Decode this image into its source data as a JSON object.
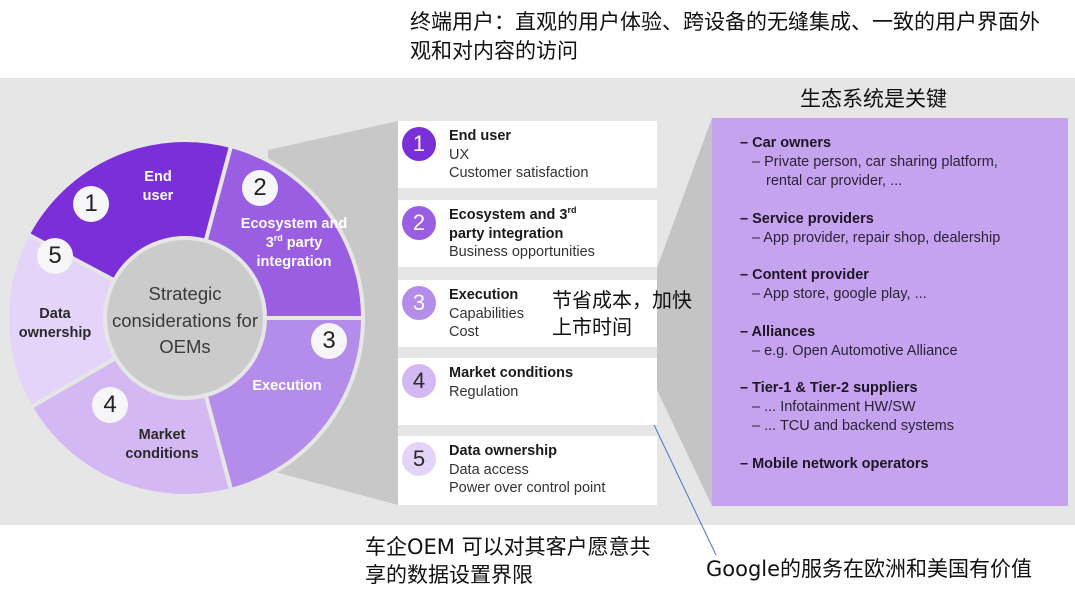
{
  "annotations": {
    "end_user_note": "终端用户：直观的用户体验、跨设备的无缝集成、一致的用户界面外观和对内容的访问",
    "ecosystem_note": "生态系统是关键",
    "execution_note": "节省成本，加快 上市时间",
    "data_ownership_note": "车企OEM 可以对其客户愿意共享的数据设置界限",
    "google_note": "Google的服务在欧洲和美国有价值"
  },
  "wheel": {
    "center_label": "Strategic considerations for OEMs",
    "segments": [
      {
        "number": "1",
        "label": "End user",
        "color": "#7b2fd8"
      },
      {
        "number": "2",
        "label_main": "Ecosystem and 3",
        "label_sup": "rd",
        "label_tail": " party integration",
        "color": "#9a5ee3"
      },
      {
        "number": "3",
        "label": "Execution",
        "color": "#b48ce9"
      },
      {
        "number": "4",
        "label": "Market conditions",
        "color": "#d4b8f4"
      },
      {
        "number": "5",
        "label": "Data ownership",
        "color": "#e5d4fa"
      }
    ],
    "hub_color": "#cbcbcb"
  },
  "cards": [
    {
      "number": "1",
      "title": "End user",
      "lines": [
        "UX",
        "Customer satisfaction"
      ],
      "color": "#7b2fd8"
    },
    {
      "number": "2",
      "title_main": "Ecosystem and 3",
      "title_sup": "rd",
      "title_tail": "party integration",
      "lines": [
        "Business opportunities"
      ],
      "color": "#9a5ee3"
    },
    {
      "number": "3",
      "title": "Execution",
      "lines": [
        "Capabilities",
        "Cost"
      ],
      "color": "#b48ce9"
    },
    {
      "number": "4",
      "title": "Market conditions",
      "lines": [
        "Regulation"
      ],
      "color": "#d4b8f4"
    },
    {
      "number": "5",
      "title": "Data ownership",
      "lines": [
        "Data access",
        "Power over control point"
      ],
      "color": "#e5d4fa"
    }
  ],
  "ecosystem": {
    "color": "#c6a3ee",
    "groups": [
      {
        "head": "– Car owners",
        "subs": [
          "– Private person, car sharing platform,",
          "rental car provider, ..."
        ]
      },
      {
        "head": "– Service providers",
        "subs": [
          "– App provider, repair shop, dealership"
        ]
      },
      {
        "head": "– Content provider",
        "subs": [
          "– App store, google play, ..."
        ]
      },
      {
        "head": "– Alliances",
        "subs": [
          "– e.g. Open Automotive Alliance"
        ]
      },
      {
        "head": "– Tier-1 & Tier-2 suppliers",
        "subs": [
          "– ... Infotainment HW/SW",
          "– ... TCU and backend systems"
        ]
      },
      {
        "head": "– Mobile network operators",
        "subs": []
      }
    ]
  },
  "colors": {
    "band": "#e6e6e6",
    "connector": "#c8c8c8",
    "arrow": "#4f74c9"
  }
}
